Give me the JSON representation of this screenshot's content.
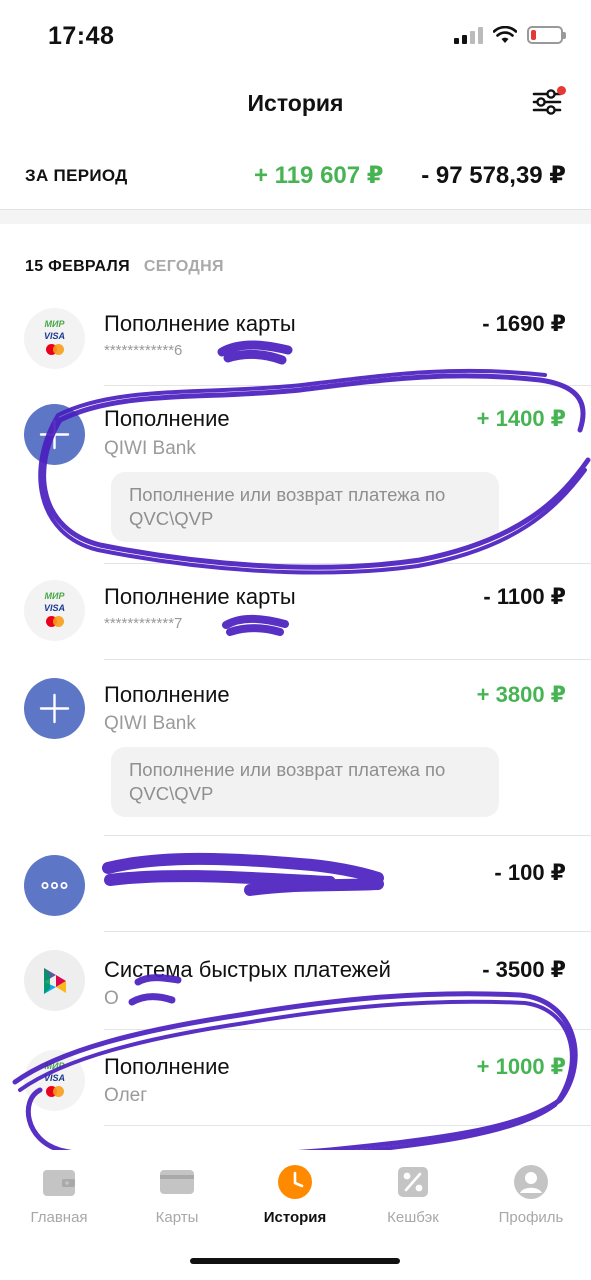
{
  "status_bar": {
    "time": "17:48"
  },
  "header": {
    "title": "История"
  },
  "period": {
    "label": "ЗА ПЕРИОД",
    "income": "+ 119 607 ₽",
    "expense": "- 97 578,39 ₽"
  },
  "date_group": {
    "day": "15 ФЕВРАЛЯ",
    "relative": "СЕГОДНЯ"
  },
  "transactions": [
    {
      "title": "Пополнение карты",
      "subtitle": "************6",
      "amount": "- 1690 ₽",
      "icon": "mir-visa-mastercard-icon"
    },
    {
      "title": "Пополнение",
      "subtitle": "QIWI Bank",
      "amount": "+ 1400 ₽",
      "note": "Пополнение или возврат платежа по QVC\\QVP",
      "icon": "plus-icon"
    },
    {
      "title": "Пополнение карты",
      "subtitle": "************7",
      "amount": "- 1100 ₽",
      "icon": "mir-visa-mastercard-icon"
    },
    {
      "title": "Пополнение",
      "subtitle": "QIWI Bank",
      "amount": "+ 3800 ₽",
      "note": "Пополнение или возврат платежа по QVC\\QVP",
      "icon": "plus-icon"
    },
    {
      "title": "",
      "subtitle": "",
      "amount": "- 100 ₽",
      "icon": "more-dots-icon"
    },
    {
      "title": "Система быстрых платежей",
      "subtitle": "О",
      "amount": "- 3500 ₽",
      "icon": "sbp-icon"
    },
    {
      "title": "Пополнение",
      "subtitle": "Олег",
      "amount": "+ 1000 ₽",
      "icon": "mir-visa-mastercard-icon"
    }
  ],
  "card_logos": {
    "mir": "МИР",
    "visa": "VISA"
  },
  "tabs": [
    {
      "label": "Главная",
      "icon": "wallet-icon"
    },
    {
      "label": "Карты",
      "icon": "card-icon"
    },
    {
      "label": "История",
      "icon": "clock-icon",
      "active": true
    },
    {
      "label": "Кешбэк",
      "icon": "percent-icon"
    },
    {
      "label": "Профиль",
      "icon": "profile-icon"
    }
  ],
  "colors": {
    "positive": "#47b454",
    "accent": "#ff8a00",
    "plus_icon_bg": "#5d77c6",
    "scribble": "#4b1fbf"
  }
}
